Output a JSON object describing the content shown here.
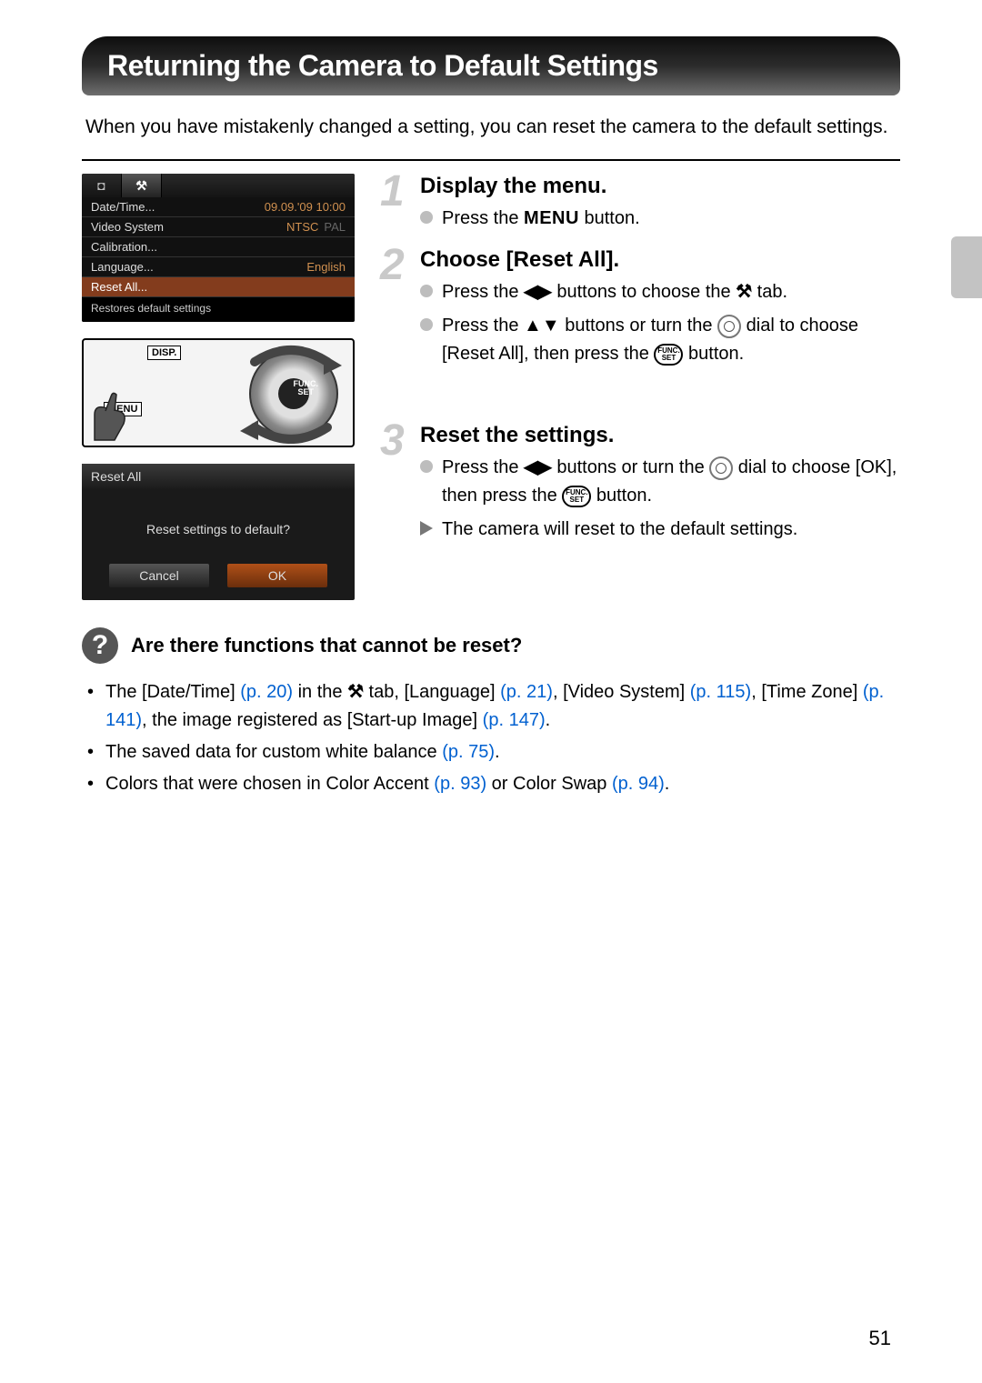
{
  "page": {
    "title": "Returning the Camera to Default Settings",
    "intro": "When you have mistakenly changed a setting, you can reset the camera to the default settings.",
    "number": "51"
  },
  "lcd_menu": {
    "tab_camera": "◘",
    "tab_tools": "⚒",
    "rows": [
      {
        "label": "Date/Time...",
        "value": "09.09.'09 10:00"
      },
      {
        "label": "Video System",
        "value": "NTSC",
        "value_dim": "PAL"
      },
      {
        "label": "Calibration...",
        "value": ""
      },
      {
        "label": "Language...",
        "value": "English"
      },
      {
        "label": "Reset All...",
        "value": "",
        "hl": true
      }
    ],
    "hint": "Restores default settings"
  },
  "dial": {
    "disp": "DISP.",
    "menu": "MENU",
    "func": "FUNC.\nSET"
  },
  "dialog": {
    "title": "Reset All",
    "message": "Reset settings to default?",
    "cancel": "Cancel",
    "ok": "OK"
  },
  "steps": [
    {
      "num": "1",
      "title": "Display the menu.",
      "bullets": [
        {
          "pre": "Press the ",
          "icon_type": "menu",
          "icon": "MENU",
          "post": " button."
        }
      ]
    },
    {
      "num": "2",
      "title": "Choose [Reset All].",
      "bullets": [
        {
          "pre": "Press the ",
          "icon_type": "lr",
          "icon": "◀▶",
          "post": " buttons to choose the ",
          "icon2_type": "tools",
          "icon2": "⚒",
          "post2": " tab."
        },
        {
          "pre": "Press the ",
          "icon_type": "ud",
          "icon": "▲▼",
          "post": " buttons or turn the ",
          "icon2_type": "dial",
          "post2": " dial to choose [Reset All], then press the ",
          "icon3_type": "funcset",
          "post3": " button."
        }
      ]
    },
    {
      "num": "3",
      "title": "Reset the settings.",
      "bullets": [
        {
          "pre": "Press the ",
          "icon_type": "lr",
          "icon": "◀▶",
          "post": " buttons or turn the ",
          "icon2_type": "dial",
          "post2": " dial to choose [OK], then press the ",
          "icon3_type": "funcset",
          "post3": " button."
        }
      ],
      "result": "The camera will reset to the default settings."
    }
  ],
  "question": {
    "heading": "Are there functions that cannot be reset?",
    "items": [
      {
        "parts": [
          {
            "t": "The [Date/Time] "
          },
          {
            "t": "(p. 20)",
            "cls": "pref"
          },
          {
            "t": " in the "
          },
          {
            "icon": "tools"
          },
          {
            "t": " tab, [Language] "
          },
          {
            "t": "(p. 21)",
            "cls": "pref"
          },
          {
            "t": ", [Video System] "
          },
          {
            "t": "(p. 115)",
            "cls": "pref"
          },
          {
            "t": ", [Time Zone] "
          },
          {
            "t": "(p. 141)",
            "cls": "pref"
          },
          {
            "t": ", the image registered as [Start-up Image] "
          },
          {
            "t": "(p. 147)",
            "cls": "pref"
          },
          {
            "t": "."
          }
        ]
      },
      {
        "parts": [
          {
            "t": "The saved data for custom white balance "
          },
          {
            "t": "(p. 75)",
            "cls": "pref"
          },
          {
            "t": "."
          }
        ]
      },
      {
        "parts": [
          {
            "t": "Colors that were chosen in Color Accent "
          },
          {
            "t": "(p. 93)",
            "cls": "pref"
          },
          {
            "t": " or Color Swap "
          },
          {
            "t": "(p. 94)",
            "cls": "pref"
          },
          {
            "t": "."
          }
        ]
      }
    ]
  },
  "funcset_label": {
    "top": "FUNC.",
    "bot": "SET"
  }
}
